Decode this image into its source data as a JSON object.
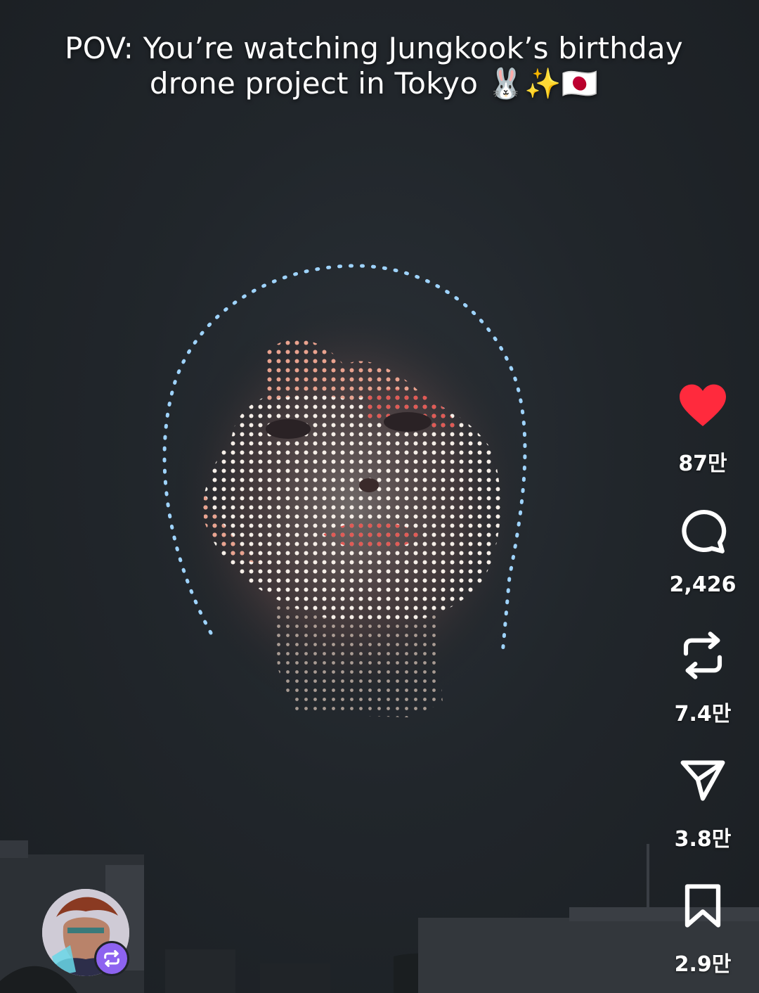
{
  "caption": {
    "line1": "POV: You’re watching Jungkook’s birthday",
    "line2": "drone project in Tokyo 🐰✨🇯🇵"
  },
  "actions": [
    {
      "name": "like",
      "icon": "heart-icon",
      "count": "87만",
      "color": "#ff2a3d"
    },
    {
      "name": "comment",
      "icon": "comment-icon",
      "count": "2,426"
    },
    {
      "name": "repost",
      "icon": "repost-icon",
      "count": "7.4만"
    },
    {
      "name": "share",
      "icon": "send-icon",
      "count": "3.8만"
    },
    {
      "name": "save",
      "icon": "bookmark-icon",
      "count": "2.9만"
    }
  ],
  "avatar": {
    "icon": "profile-avatar",
    "badge_icon": "repost-badge-icon",
    "badge_color": "#8d63f0"
  }
}
